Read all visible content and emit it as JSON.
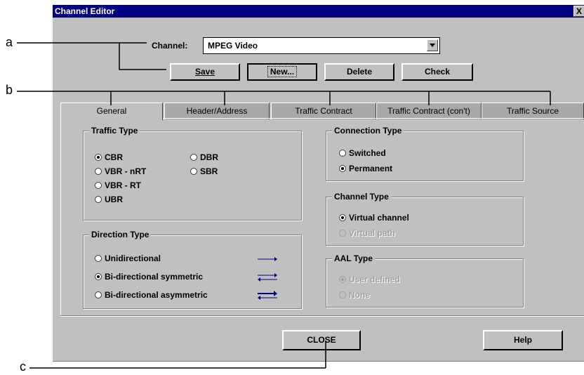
{
  "window": {
    "title": "Channel Editor",
    "close_glyph": "X"
  },
  "channel": {
    "label": "Channel:",
    "value": "MPEG Video"
  },
  "buttons": {
    "save": "Save",
    "new": "New...",
    "delete": "Delete",
    "check": "Check",
    "close": "CLOSE",
    "help": "Help"
  },
  "tabs": [
    "General",
    "Header/Address",
    "Traffic Contract",
    "Traffic Contract (con't)",
    "Traffic Source"
  ],
  "traffic_type": {
    "title": "Traffic Type",
    "options": [
      {
        "label": "CBR",
        "selected": true
      },
      {
        "label": "VBR - nRT",
        "selected": false
      },
      {
        "label": "VBR - RT",
        "selected": false
      },
      {
        "label": "UBR",
        "selected": false
      },
      {
        "label": "DBR",
        "selected": false
      },
      {
        "label": "SBR",
        "selected": false
      }
    ]
  },
  "direction_type": {
    "title": "Direction Type",
    "options": [
      {
        "label": "Unidirectional",
        "selected": false
      },
      {
        "label": "Bi-directional symmetric",
        "selected": true
      },
      {
        "label": "Bi-directional asymmetric",
        "selected": false
      }
    ]
  },
  "connection_type": {
    "title": "Connection Type",
    "options": [
      {
        "label": "Switched",
        "selected": false
      },
      {
        "label": "Permanent",
        "selected": true
      }
    ]
  },
  "channel_type": {
    "title": "Channel Type",
    "options": [
      {
        "label": "Virtual channel",
        "selected": true
      },
      {
        "label": "Virtual path",
        "selected": false,
        "disabled": true
      }
    ]
  },
  "aal_type": {
    "title": "AAL Type",
    "options": [
      {
        "label": "User defined",
        "selected": true,
        "disabled": true
      },
      {
        "label": "None",
        "selected": false,
        "disabled": true
      }
    ]
  },
  "callouts": [
    "a",
    "b",
    "c"
  ],
  "colors": {
    "titlebar": "#000080",
    "face": "#c0c0c0",
    "arrow": "#000080"
  }
}
